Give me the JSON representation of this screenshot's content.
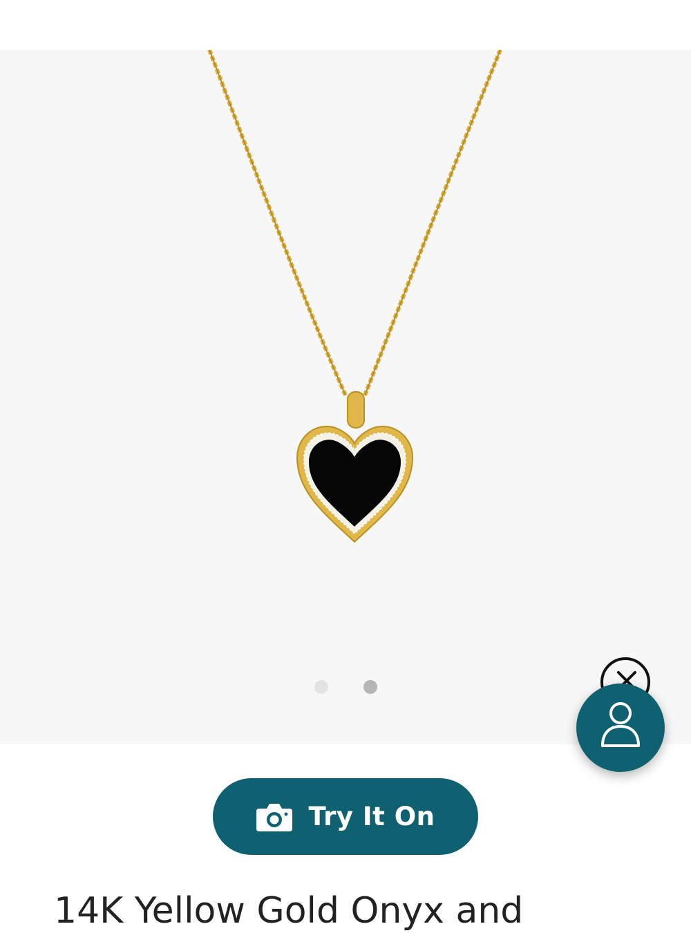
{
  "colors": {
    "brand_teal": "#0f6171",
    "gallery_background": "#f7f7f7",
    "gold": "#d4a93a",
    "onyx": "#050505"
  },
  "gallery": {
    "image_alt": "14K Yellow Gold Onyx and",
    "active_dot": 2,
    "dot_count": 2
  },
  "widget": {
    "close_icon": "close-icon",
    "account_icon": "person-icon"
  },
  "try_on": {
    "icon": "camera-icon",
    "label": "Try It On"
  },
  "product": {
    "title": "14K Yellow Gold Onyx and"
  }
}
